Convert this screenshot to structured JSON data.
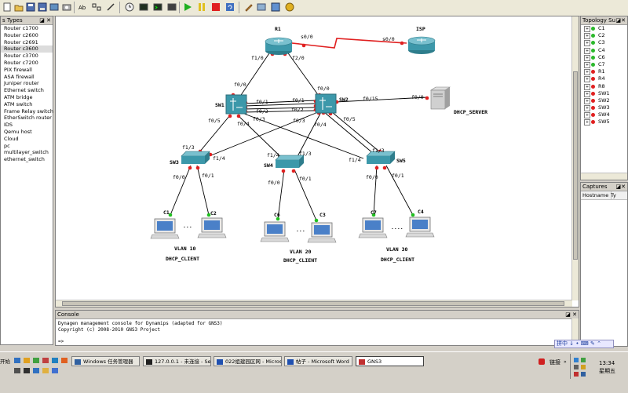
{
  "node_types_panel": {
    "title": "s Types",
    "items": [
      "Router c1700",
      "Router c2600",
      "Router c2691",
      "Router c3600",
      "Router c3700",
      "Router c7200",
      "PIX firewall",
      "ASA firewall",
      "Juniper router",
      "Ethernet switch",
      "ATM bridge",
      "ATM switch",
      "Frame Relay switch",
      "EtherSwitch router",
      "IDS",
      "Qemu host",
      "Cloud",
      "pc",
      "multilayer_switch",
      "ethernet_switch"
    ],
    "selected_index": 3
  },
  "topology_panel": {
    "title": "Topology Su",
    "nodes": [
      {
        "name": "C1",
        "color": "#2cb82c"
      },
      {
        "name": "C2",
        "color": "#2cb82c"
      },
      {
        "name": "C3",
        "color": "#2cb82c"
      },
      {
        "name": "C4",
        "color": "#2cb82c"
      },
      {
        "name": "C6",
        "color": "#2cb82c"
      },
      {
        "name": "C7",
        "color": "#2cb82c"
      },
      {
        "name": "R1",
        "color": "#e02020"
      },
      {
        "name": "R4",
        "color": "#e02020"
      },
      {
        "name": "R8",
        "color": "#e02020"
      },
      {
        "name": "SW1",
        "color": "#e02020"
      },
      {
        "name": "SW2",
        "color": "#e02020"
      },
      {
        "name": "SW3",
        "color": "#e02020"
      },
      {
        "name": "SW4",
        "color": "#e02020"
      },
      {
        "name": "SW5",
        "color": "#e02020"
      }
    ]
  },
  "captures_panel": {
    "title": "Captures",
    "columns": [
      "Hostname",
      "Ty"
    ]
  },
  "topology": {
    "devices": {
      "R1": "R1",
      "ISP": "ISP",
      "SW1": "SW1",
      "SW2": "SW2",
      "SW3": "SW3",
      "SW4": "SW4",
      "SW5": "SW5",
      "DHCP_SERVER": "DHCP_SERVER",
      "C1": "C1",
      "C2": "C2",
      "C6": "C6",
      "C3": "C3",
      "C7": "C7",
      "C4": "C4"
    },
    "ellipses": [
      "...",
      "...",
      "...."
    ],
    "interfaces": {
      "r1_s00": "s0/0",
      "isp_s00": "s0/0",
      "r1_f10": "f1/0",
      "r1_f20": "f2/0",
      "sw1_f00": "f0/0",
      "sw2_f00": "f0/0",
      "sw1_f01": "f0/1",
      "sw1_f02": "f0/2",
      "sw1_f03": "f0/3",
      "sw1_f04": "f0/4",
      "sw1_f05": "f0/5",
      "sw2_f01": "f0/1",
      "sw2_f02": "f0/2",
      "sw2_f03": "f0/3",
      "sw2_f04": "f0/4",
      "sw2_f05": "f0/5",
      "sw2_f015": "f0/15",
      "srv_f00": "f0/0",
      "sw3_f13": "f1/3",
      "sw3_f14": "f1/4",
      "sw3_f00": "f0/0",
      "sw3_f01": "f0/1",
      "sw4_f14": "f1/4",
      "sw4_f13": "f1/3",
      "sw4_f00": "f0/0",
      "sw4_f01": "f0/1",
      "sw5_f13": "f1/3",
      "sw5_f14": "f1/4",
      "sw5_f00": "f0/0",
      "sw5_f01": "f0/1"
    },
    "vlans": [
      {
        "vlan": "VLAN 10",
        "client": "DHCP_CLIENT"
      },
      {
        "vlan": "VLAN 20",
        "client": "DHCP_CLIENT"
      },
      {
        "vlan": "VLAN 30",
        "client": "DHCP_CLIENT"
      }
    ]
  },
  "console": {
    "title": "Console",
    "lines": [
      "Dynagen management console for Dynamips (adapted for GNS3)",
      "Copyright (c) 2008-2010 GNS3 Project",
      "",
      "=>"
    ]
  },
  "taskbar": {
    "start_label": "开始",
    "tasks": [
      {
        "label": "Windows 任务管理器"
      },
      {
        "label": "127.0.0.1 - 未连接 - Se..."
      },
      {
        "label": "022组建园区网 - Micros..."
      },
      {
        "label": "帖子 - Microsoft Word"
      },
      {
        "label": "GNS3"
      }
    ],
    "tray_link": "链接",
    "clock_time": "13:34",
    "clock_day": "星期五"
  }
}
